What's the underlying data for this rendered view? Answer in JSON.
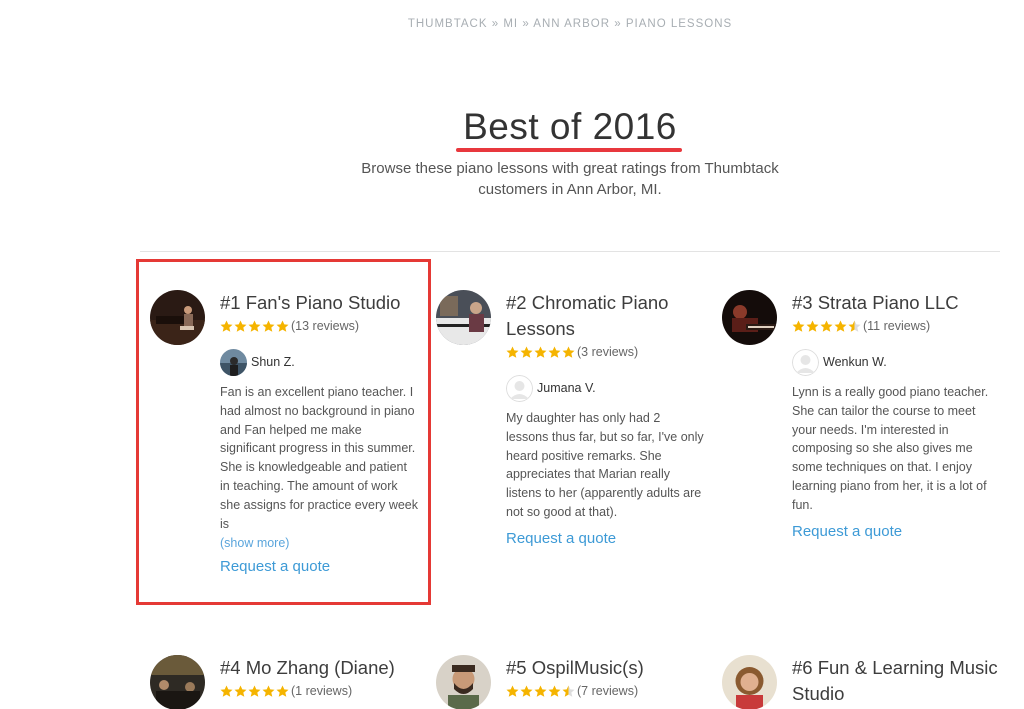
{
  "breadcrumb": {
    "items": [
      "THUMBTACK",
      "MI",
      "ANN ARBOR",
      "PIANO LESSONS"
    ],
    "separator": "»"
  },
  "hero": {
    "title": "Best of 2016",
    "subtitle": "Browse these piano lessons with great ratings from Thumbtack customers in Ann Arbor, MI.",
    "underline_color": "#e8383d"
  },
  "colors": {
    "star": "#f5b400",
    "link": "#3d9ad6",
    "highlight": "#e53935"
  },
  "pros": [
    {
      "name": "#1 Fan's Piano Studio",
      "rating": 5,
      "review_count": "(13 reviews)",
      "reviewer": "Shun Z.",
      "review": "Fan is an excellent piano teacher. I had almost no background in piano and Fan helped me make significant progress in this summer. She is knowledgeable and patient in teaching. The amount of work she assigns for practice every week is",
      "show_more": "(show more)",
      "quote": "Request a quote"
    },
    {
      "name": "#2 Chromatic Piano Lessons",
      "rating": 5,
      "review_count": "(3 reviews)",
      "reviewer": "Jumana V.",
      "review": "My daughter has only had 2 lessons thus far, but so far, I've only heard positive remarks. She appreciates that Marian really listens to her (apparently adults are not so good at that).",
      "quote": "Request a quote"
    },
    {
      "name": "#3 Strata Piano LLC",
      "rating": 4.5,
      "review_count": "(11 reviews)",
      "reviewer": "Wenkun W.",
      "review": "Lynn is a really good piano teacher. She can tailor the course to meet your needs. I'm interested in composing so she also gives me some techniques on that. I enjoy learning piano from her, it is a lot of fun.",
      "quote": "Request a quote"
    },
    {
      "name": "#4 Mo Zhang (Diane)",
      "rating": 5,
      "review_count": "(1 reviews)"
    },
    {
      "name": "#5 OspilMusic(s)",
      "rating": 4.5,
      "review_count": "(7 reviews)"
    },
    {
      "name": "#6 Fun & Learning Music Studio",
      "rating": 0
    }
  ]
}
